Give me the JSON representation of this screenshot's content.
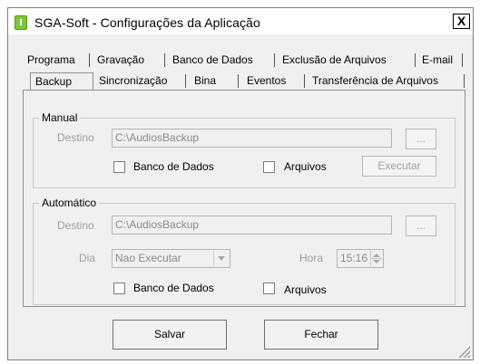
{
  "window": {
    "title": "SGA-Soft - Configurações da Aplicação",
    "close_glyph": "X"
  },
  "tabs": {
    "row1": [
      "Programa",
      "Gravação",
      "Banco de Dados",
      "Exclusão de Arquivos",
      "E-mail"
    ],
    "row2": [
      "Backup",
      "Sincronização",
      "Bina",
      "Eventos",
      "Transferência de Arquivos"
    ],
    "active": "Backup"
  },
  "manual": {
    "legend": "Manual",
    "destino_label": "Destino",
    "destino_value": "C:\\AudiosBackup",
    "browse_label": "...",
    "banco_label": "Banco de Dados",
    "arquivos_label": "Arquivos",
    "executar_label": "Executar"
  },
  "automatico": {
    "legend": "Automático",
    "destino_label": "Destino",
    "destino_value": "C:\\AudiosBackup",
    "browse_label": "...",
    "dia_label": "Dia",
    "dia_value": "Nao Executar",
    "hora_label": "Hora",
    "hora_value": "15:16",
    "banco_label": "Banco de Dados",
    "arquivos_label": "Arquivos"
  },
  "footer": {
    "save_label": "Salvar",
    "close_label": "Fechar"
  },
  "colors": {
    "accent": "#7ec832",
    "window_bg": "#f0f0f0",
    "disabled_text": "#a0a0a0"
  }
}
